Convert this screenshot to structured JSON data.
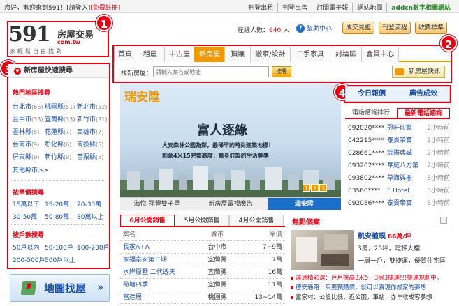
{
  "topbar": {
    "greeting": "您好，歡迎來到591！",
    "login": "[請登入]",
    "register": "[免費註冊]",
    "links": [
      "刊登出租",
      "刊登出售",
      "訂閱電子報",
      "網站地圖",
      "addcn數字相關網站"
    ]
  },
  "logo": {
    "number": "591",
    "title": "房屋交易",
    "url": "com.tw",
    "slogan": "家輕鬆自由找到"
  },
  "markers": [
    "1",
    "2",
    "3",
    "4"
  ],
  "header": {
    "online_label": "在線人數：",
    "online_count": "640",
    "online_unit": "人",
    "help": "幫助中心",
    "buttons": [
      "成交見證",
      "刊登流程",
      "收費標準"
    ]
  },
  "nav": {
    "tabs": [
      "首頁",
      "租屋",
      "中古屋",
      "新房屋",
      "頂讓",
      "搬家/設計",
      "二手家具",
      "討論區",
      "會員中心"
    ],
    "active_index": 3
  },
  "search": {
    "label": "找新房屋：",
    "placeholder": "請輸入案名或地址",
    "button": "搜尋",
    "flash": "新房屋快訊"
  },
  "left": {
    "title": "新房屋快速搜尋",
    "hot_title": "熱門地區搜尋",
    "areas": [
      {
        "name": "台北市",
        "count": "(66)"
      },
      {
        "name": "桃園縣",
        "count": "(51)"
      },
      {
        "name": "新北市",
        "count": "(52)"
      },
      {
        "name": "台中市",
        "count": "(33)"
      },
      {
        "name": "宜蘭縣",
        "count": "(33)"
      },
      {
        "name": "新竹市",
        "count": "(31)"
      },
      {
        "name": "雲林縣",
        "count": "(5)"
      },
      {
        "name": "花蓮縣",
        "count": "(7)"
      },
      {
        "name": "高雄市",
        "count": "(7)"
      },
      {
        "name": "台南市",
        "count": "(9)"
      },
      {
        "name": "彰化縣",
        "count": "(6)"
      },
      {
        "name": "南投縣",
        "count": "(5)"
      },
      {
        "name": "屏東縣",
        "count": "(9)"
      },
      {
        "name": "新竹縣",
        "count": "(9)"
      },
      {
        "name": "苗栗縣",
        "count": "(5)"
      }
    ],
    "more": "其他縣市>>",
    "price_title": "按單價搜尋",
    "prices": [
      "15萬以下",
      "15-20萬",
      "20-30萬",
      "30-50萬",
      "50-80萬",
      "80萬以上"
    ],
    "total_title": "按戶數搜尋",
    "totals": [
      "50戶以內",
      "50-100戶",
      "100-200戶",
      "200-500戶",
      "500戶以上"
    ]
  },
  "mapbtn": {
    "label": "地圖找屋",
    "arrow": "»"
  },
  "banner": {
    "brand": "瑞安陞",
    "headline": "富人逐綠",
    "sub1": "大安森林公園為鄰，最稀罕的時尚建築地標！",
    "sub2": "創意4米15完整高度，量身訂製的生活美學",
    "pages": [
      "1",
      "2",
      "3"
    ],
    "tabs": [
      "海悅-翔豐雙子星",
      "新房屋電視廣告",
      "瑞安陞"
    ],
    "active_tab": 2
  },
  "sales": {
    "tabs": [
      "6月公開銷售",
      "5月公開銷售",
      "4月公開銷售"
    ],
    "headers": [
      "案名",
      "縣市",
      "單價"
    ],
    "rows": [
      {
        "name": "長家A+A",
        "city": "台中市",
        "price": "7~9萬"
      },
      {
        "name": "家福泰安第二期",
        "city": "宜蘭縣",
        "price": "7萬"
      },
      {
        "name": "水岸原墅 二代透天",
        "city": "宜蘭縣",
        "price": "16萬"
      },
      {
        "name": "荷塘四季",
        "city": "宜蘭縣",
        "price": "11萬"
      },
      {
        "name": "富達居",
        "city": "桃園縣",
        "price": "13~14萬"
      }
    ]
  },
  "right": {
    "tabs": [
      "今日報價",
      "廣告成效"
    ],
    "phone_tabs": [
      "電話諮詢排行",
      "最新電話諮詢"
    ],
    "phone_active": 1,
    "calls": [
      {
        "phone": "092020****",
        "name": "冠軒印象",
        "time": "2小時前"
      },
      {
        "phone": "042215****",
        "name": "泰貴帝寶",
        "time": "2小時前"
      },
      {
        "phone": "028661****",
        "name": "瑞塔典誠",
        "time": "2小時前"
      },
      {
        "phone": "093202****",
        "name": "華威八方第",
        "time": "2小時前"
      },
      {
        "phone": "093802****",
        "name": "草海與樹",
        "time": "3小時前"
      },
      {
        "phone": "03560****",
        "name": "F Hotel",
        "time": "3小時前"
      },
      {
        "phone": "092086****",
        "name": "泰貴帝寶",
        "time": "3小時前"
      }
    ]
  },
  "focus": {
    "title": "焦點個案",
    "name": "凱安植璞",
    "price": "66萬/坪",
    "line1": "3房，25坪，電梯大樓",
    "line2": "一層一戶，雙捷運，優質住宅區",
    "news": [
      "達通精彩選：戶戶挑高3米5，3房3捷運!!!捷運規劃中。",
      "德安通路：只要預購價，就可以實現你成家的夢想",
      "富家村：公設比低，近公園，車站，赤年收成客夢想"
    ]
  },
  "colors": {
    "brand": "#e60012",
    "accent": "#f39800",
    "link": "#1a4ea8"
  }
}
